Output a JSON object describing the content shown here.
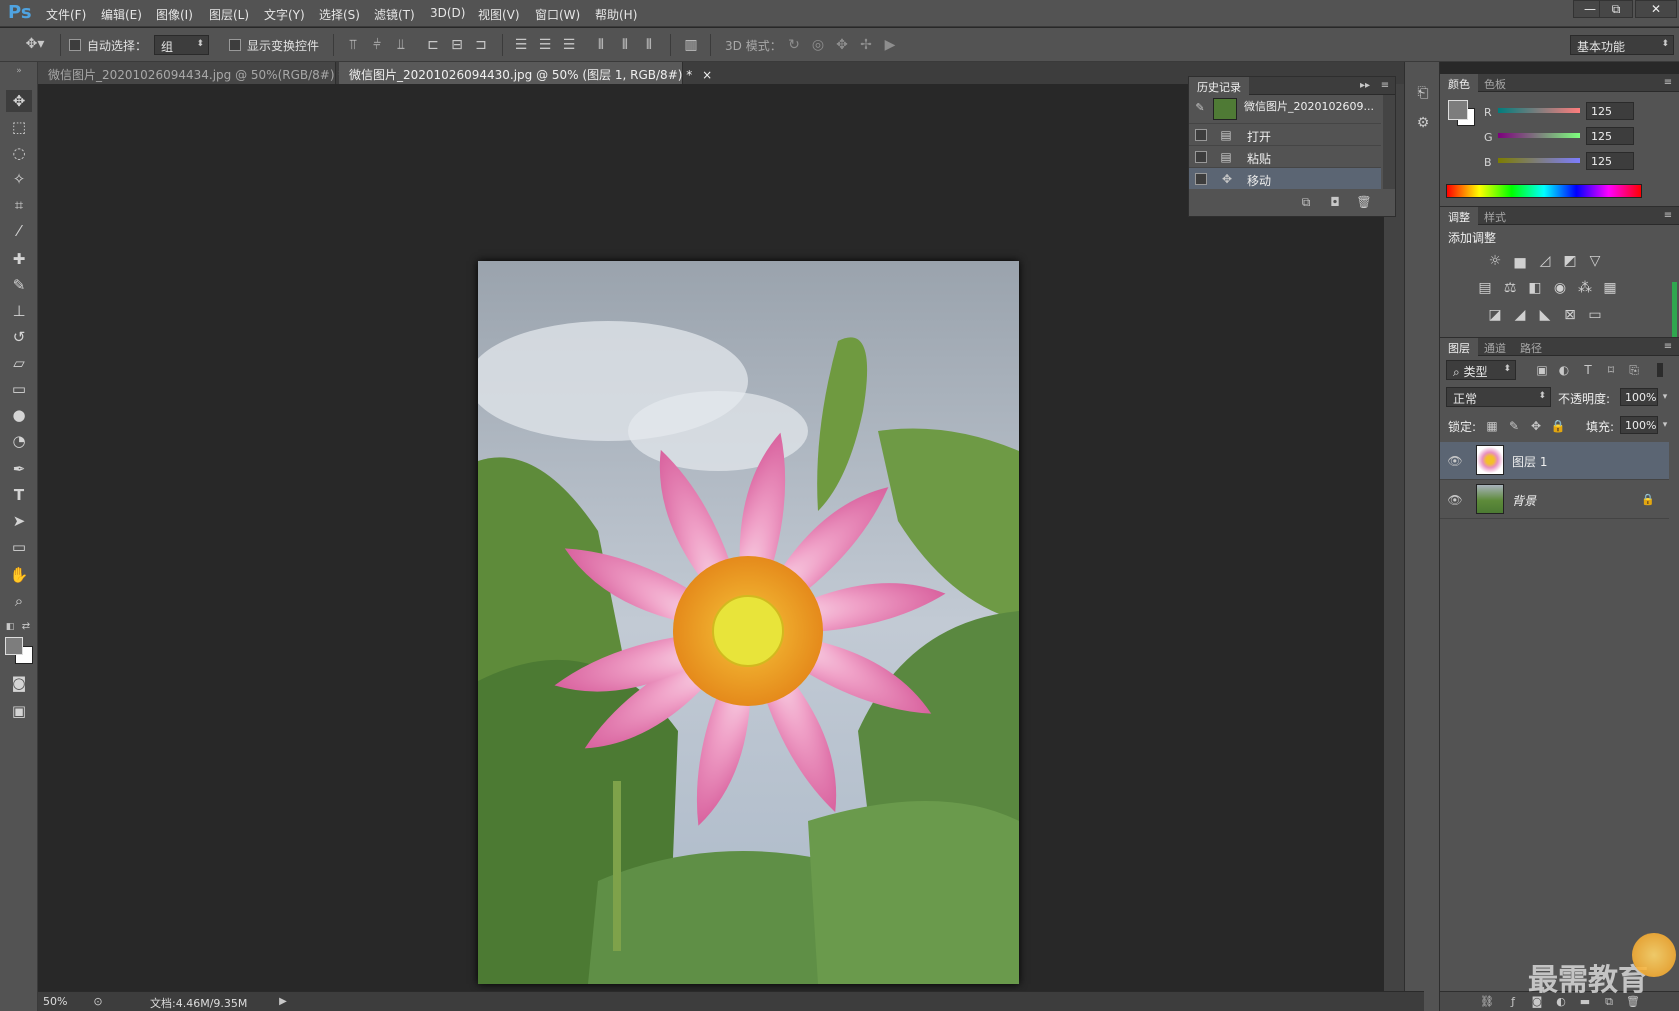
{
  "app": {
    "logo": "Ps"
  },
  "menu": [
    "文件(F)",
    "编辑(E)",
    "图像(I)",
    "图层(L)",
    "文字(Y)",
    "选择(S)",
    "滤镜(T)",
    "3D(D)",
    "视图(V)",
    "窗口(W)",
    "帮助(H)"
  ],
  "window_controls": {
    "minimize": "—",
    "restore": "⧉",
    "close": "✕"
  },
  "options": {
    "auto_select_label": "自动选择：",
    "auto_select_value": "组",
    "show_transform_label": "显示变换控件",
    "mode_3d_label": "3D 模式：",
    "workspace": "基本功能"
  },
  "tabs": [
    {
      "label": "微信图片_20201026094434.jpg @ 50%(RGB/8#) *",
      "close": "×"
    },
    {
      "label": "微信图片_20201026094430.jpg @ 50% (图层 1, RGB/8#) *",
      "close": "×"
    }
  ],
  "history": {
    "tab": "历史记录",
    "snapshot": "微信图片_2020102609...",
    "items": [
      "打开",
      "粘贴",
      "移动"
    ]
  },
  "color_panel": {
    "tabs": [
      "颜色",
      "色板"
    ],
    "channels": [
      {
        "name": "R",
        "value": "125"
      },
      {
        "name": "G",
        "value": "125"
      },
      {
        "name": "B",
        "value": "125"
      }
    ]
  },
  "adjustments_panel": {
    "tabs": [
      "调整",
      "样式"
    ],
    "title": "添加调整"
  },
  "layers_panel": {
    "tabs": [
      "图层",
      "通道",
      "路径"
    ],
    "filter": "类型",
    "blend_mode": "正常",
    "opacity_label": "不透明度:",
    "opacity": "100%",
    "lock_label": "锁定:",
    "fill_label": "填充:",
    "fill": "100%",
    "layers": [
      {
        "name": "图层 1"
      },
      {
        "name": "背景"
      }
    ]
  },
  "status": {
    "zoom": "50%",
    "doc": "文档:4.46M/9.35M"
  },
  "watermark": "最需教育",
  "colors": {
    "accent": "#4fa3e0",
    "selected": "#5b6573",
    "panel": "#535353",
    "canvas": "#282828"
  }
}
